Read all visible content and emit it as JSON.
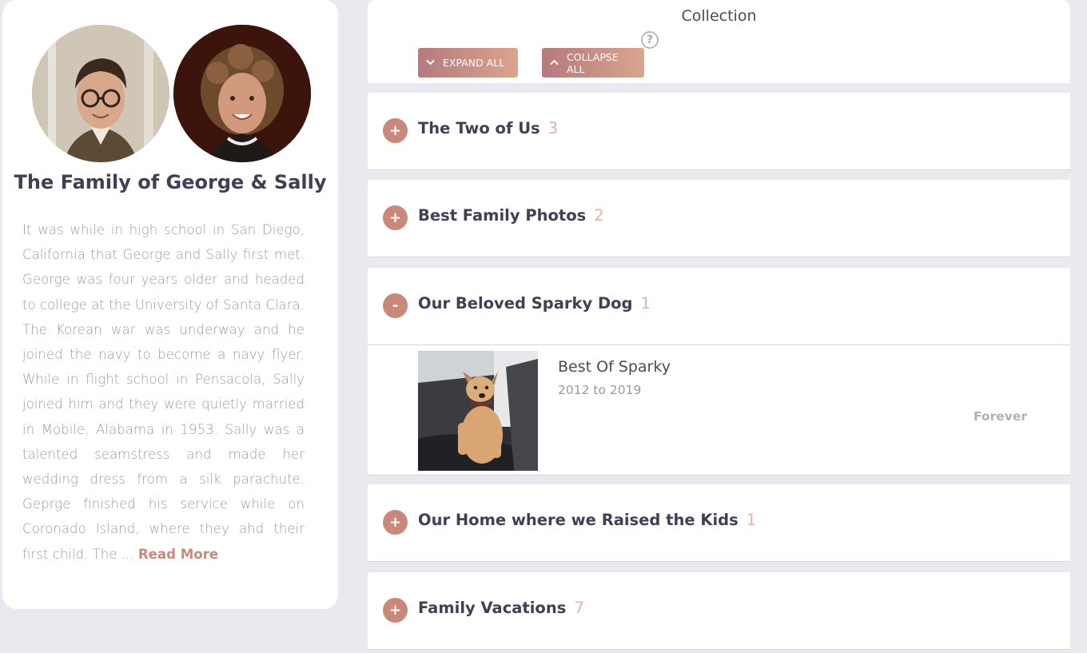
{
  "profile": {
    "title": "The Family of George & Sally",
    "story": "It was while in high school in San Diego, California that George and Sally first met. George was four years older and headed to college at the University of Santa Clara.  The Korean war was underway and he joined the navy to become a navy flyer. While in flight school in Pensacola, Sally joined him and they were quietly married in Mobile, Alabama in 1953.  Sally was a talented seamstress and made her wedding dress from a silk parachute. Geprge finished his service while on Coronado Island, where they ahd their first child. The ... ",
    "read_more": "Read More"
  },
  "collection": {
    "title": "Collection",
    "help_icon": "?",
    "expand_label": "EXPAND ALL",
    "collapse_label": "COLLAPSE ALL",
    "expand_icon": "chevron-down-icon",
    "collapse_icon": "chevron-up-icon"
  },
  "sections": [
    {
      "title": "The Two of Us",
      "count": "3",
      "toggle": "+",
      "expanded": false
    },
    {
      "title": "Best Family Photos",
      "count": "2",
      "toggle": "+",
      "expanded": false
    },
    {
      "title": "Our Beloved Sparky Dog",
      "count": "1",
      "toggle": "-",
      "expanded": true,
      "items": [
        {
          "name": "Best Of Sparky",
          "dates": "2012 to 2019",
          "duration": "Forever"
        }
      ]
    },
    {
      "title": "Our Home where we Raised the Kids",
      "count": "1",
      "toggle": "+",
      "expanded": false
    },
    {
      "title": "Family Vacations",
      "count": "7",
      "toggle": "+",
      "expanded": false
    }
  ],
  "colors": {
    "accent": "#c9887a",
    "count": "#e4b3a6",
    "button_start": "#b47a7e",
    "button_end": "#dba48c",
    "background": "#e8eaf0"
  }
}
